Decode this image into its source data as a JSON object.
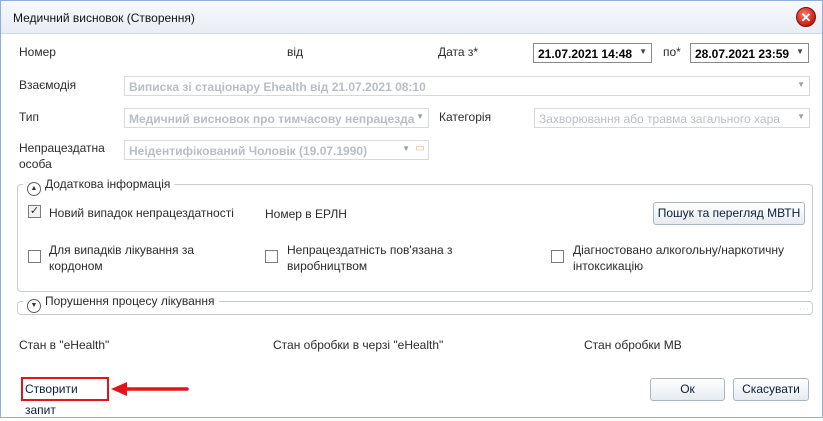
{
  "window": {
    "title": "Медичний висновок (Створення)",
    "close_symbol": "✕"
  },
  "form": {
    "number_label": "Номер",
    "from_label": "від",
    "date_from_label": "Дата з*",
    "date_from_value": "21.07.2021 14:48",
    "date_to_label": "по*",
    "date_to_value": "28.07.2021 23:59",
    "interaction_label": "Взаємодія",
    "interaction_value": "Виписка зі стаціонару Ehealth від 21.07.2021 08:10",
    "type_label": "Тип",
    "type_value": "Медичний висновок про тимчасову непрацезда",
    "category_label": "Категорія",
    "category_value": "Захворювання або травма загального хара",
    "person_label": "Непрацездатна особа",
    "person_value": "Неідентифікований Чоловік (19.07.1990)"
  },
  "additional": {
    "header": "Додаткова інформація",
    "new_case_label": "Новий випадок непрацездатності",
    "new_case_checked": true,
    "erln_label": "Номер в ЕРЛН",
    "search_button": "Пошук та перегляд МВТН",
    "abroad_label": "Для випадків лікування за кордоном",
    "production_label": "Непрацездатність пов'язана з виробництвом",
    "alcohol_label": "Діагностовано алкогольну/наркотичну інтоксикацію"
  },
  "violation": {
    "header": "Порушення процесу лікування"
  },
  "status": {
    "ehealth": "Стан в \"eHealth\"",
    "queue": "Стан обробки в черзі \"eHealth\"",
    "mv": "Стан обробки МВ"
  },
  "footer": {
    "create_request": "Створити запит",
    "ok": "Ок",
    "cancel": "Скасувати"
  },
  "colors": {
    "highlight": "#e5141b",
    "button_text": "#0b1e3a",
    "disabled_text": "#b9bec6"
  }
}
